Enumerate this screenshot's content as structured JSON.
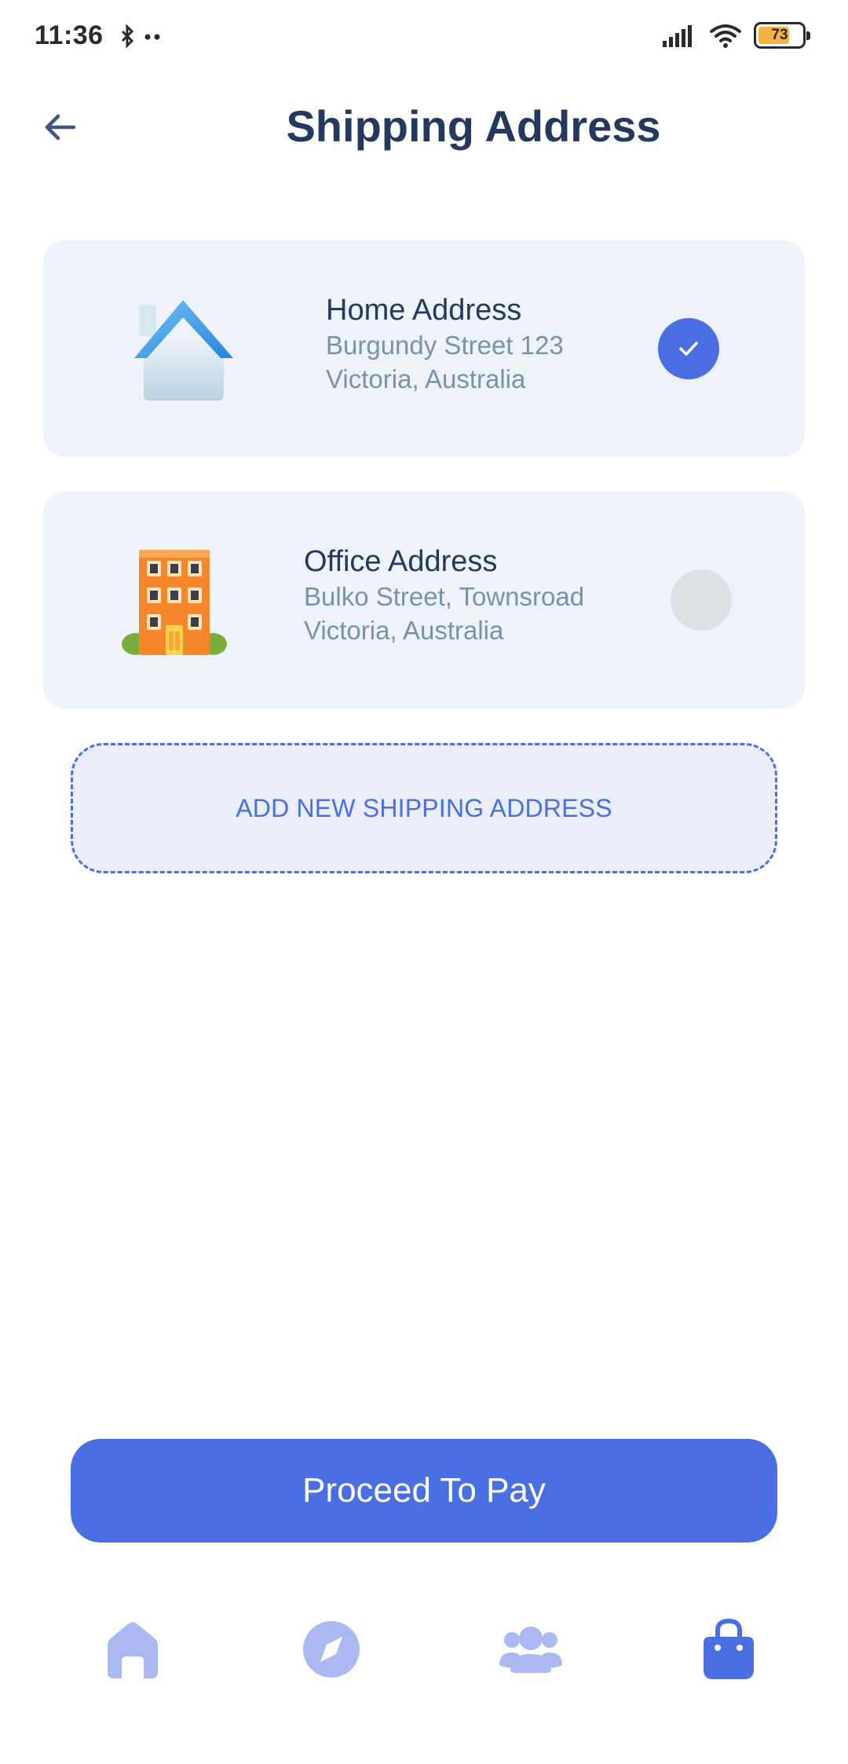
{
  "status_bar": {
    "time": "11:36",
    "battery_level": "73",
    "battery_fraction": 0.73,
    "icons": [
      "bluetooth-icon",
      "signal-icon",
      "wifi-icon",
      "battery-icon"
    ]
  },
  "header": {
    "title": "Shipping Address",
    "back_icon": "arrow-left-icon"
  },
  "addresses": [
    {
      "title": "Home Address",
      "line1": "Burgundy Street 123",
      "line2": "Victoria, Australia",
      "icon": "house-icon",
      "selected": true
    },
    {
      "title": "Office Address",
      "line1": "Bulko Street, Townsroad",
      "line2": "Victoria, Australia",
      "icon": "office-building-icon",
      "selected": false
    }
  ],
  "add_new": {
    "label": "ADD NEW SHIPPING ADDRESS"
  },
  "proceed": {
    "label": "Proceed To Pay"
  },
  "bottom_nav": {
    "items": [
      {
        "icon": "home-icon",
        "active": false
      },
      {
        "icon": "compass-icon",
        "active": false
      },
      {
        "icon": "users-icon",
        "active": false
      },
      {
        "icon": "shopping-bag-icon",
        "active": true
      }
    ]
  },
  "colors": {
    "accent": "#4a6fe3",
    "title_text": "#25395f",
    "secondary_text": "#7b90ad",
    "card_background": "#eef3f9",
    "nav_inactive": "#aab9f1"
  }
}
